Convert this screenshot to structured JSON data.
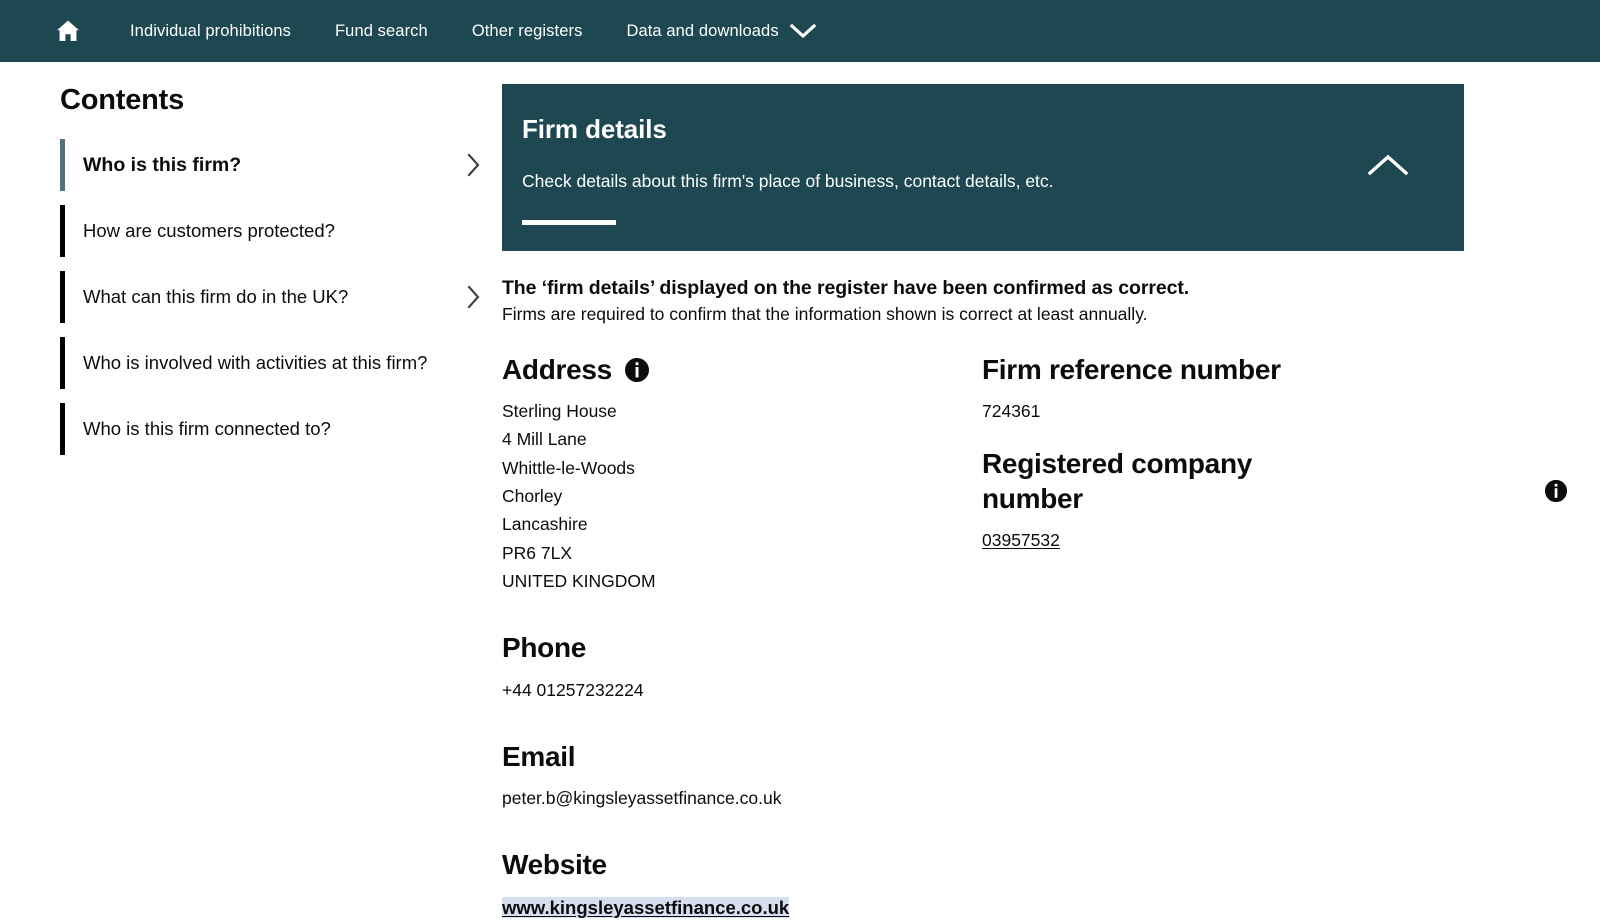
{
  "nav": {
    "home_icon": "home-icon",
    "items": [
      {
        "label": "Individual prohibitions",
        "caret": false
      },
      {
        "label": "Fund search",
        "caret": false
      },
      {
        "label": "Other registers",
        "caret": false
      },
      {
        "label": "Data and downloads",
        "caret": true
      }
    ],
    "caret_icon": "chevron-down-icon",
    "background": "#1d4751"
  },
  "sidebar": {
    "title": "Contents",
    "items": [
      {
        "label": "Who is this firm?",
        "active": true,
        "chevron": true
      },
      {
        "label": "How are customers protected?",
        "active": false,
        "chevron": false
      },
      {
        "label": "What can this firm do in the UK?",
        "active": false,
        "chevron": true
      },
      {
        "label": "Who is involved with activities at this firm?",
        "active": false,
        "chevron": false
      },
      {
        "label": "Who is this firm connected to?",
        "active": false,
        "chevron": false
      }
    ],
    "active_bar_color": "#4e747c",
    "bar_color": "#000000"
  },
  "panel": {
    "title": "Firm details",
    "subtitle": "Check details about this firm's place of business, contact details, etc.",
    "toggle_icon": "chevron-up-icon",
    "background": "#1d4751"
  },
  "confirmation": {
    "heading": "The ‘firm details’ displayed on the register have been confirmed as correct.",
    "note": "Firms are required to confirm that the information shown is correct at least annually."
  },
  "details": {
    "address": {
      "label": "Address",
      "info_icon": "info-icon",
      "lines": [
        "Sterling House",
        "4 Mill Lane",
        "Whittle-le-Woods",
        "Chorley",
        "Lancashire",
        "PR6 7LX",
        "UNITED KINGDOM"
      ]
    },
    "phone": {
      "label": "Phone",
      "value": "+44 01257232224"
    },
    "email": {
      "label": "Email",
      "value": "peter.b@kingsleyassetfinance.co.uk"
    },
    "website": {
      "label": "Website",
      "value": "www.kingsleyassetfinance.co.uk",
      "highlight_color": "#d7deef"
    },
    "firm_reference_number": {
      "label": "Firm reference number",
      "value": "724361"
    },
    "registered_company_number": {
      "label": "Registered company number",
      "value": "03957532",
      "info_icon": "info-icon"
    }
  }
}
